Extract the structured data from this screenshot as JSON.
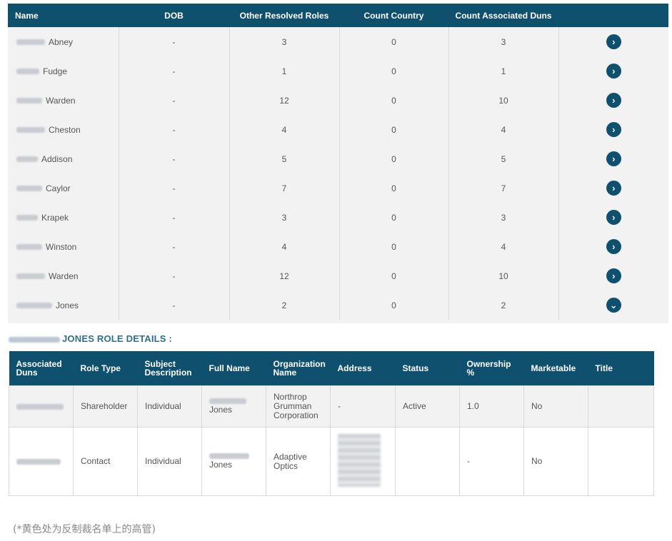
{
  "main_table": {
    "headers": [
      "Name",
      "DOB",
      "Other Resolved Roles",
      "Count Country",
      "Count Associated Duns",
      ""
    ],
    "rows": [
      {
        "surname": "Abney",
        "dob": "-",
        "roles": "3",
        "country": "0",
        "duns": "3",
        "action": "expand"
      },
      {
        "surname": "Fudge",
        "dob": "-",
        "roles": "1",
        "country": "0",
        "duns": "1",
        "action": "expand"
      },
      {
        "surname": "Warden",
        "dob": "-",
        "roles": "12",
        "country": "0",
        "duns": "10",
        "action": "expand"
      },
      {
        "surname": "Cheston",
        "dob": "-",
        "roles": "4",
        "country": "0",
        "duns": "4",
        "action": "expand"
      },
      {
        "surname": "Addison",
        "dob": "-",
        "roles": "5",
        "country": "0",
        "duns": "5",
        "action": "expand"
      },
      {
        "surname": "Caylor",
        "dob": "-",
        "roles": "7",
        "country": "0",
        "duns": "7",
        "action": "expand"
      },
      {
        "surname": "Krapek",
        "dob": "-",
        "roles": "3",
        "country": "0",
        "duns": "3",
        "action": "expand"
      },
      {
        "surname": "Winston",
        "dob": "-",
        "roles": "4",
        "country": "0",
        "duns": "4",
        "action": "expand"
      },
      {
        "surname": "Warden",
        "dob": "-",
        "roles": "12",
        "country": "0",
        "duns": "10",
        "action": "expand"
      },
      {
        "surname": "Jones",
        "dob": "-",
        "roles": "2",
        "country": "0",
        "duns": "2",
        "action": "collapse"
      }
    ]
  },
  "role_details": {
    "title": "JONES ROLE DETAILS :",
    "headers": [
      "Associated Duns",
      "Role Type",
      "Subject Description",
      "Full Name",
      "Organization Name",
      "Address",
      "Status",
      "Ownership %",
      "Marketable",
      "Title"
    ],
    "rows": [
      {
        "role_type": "Shareholder",
        "subject": "Individual",
        "full_name": "Jones",
        "org": "Northrop Grumman Corporation",
        "address": "-",
        "status": "Active",
        "ownership": "1.0",
        "marketable": "No",
        "title": ""
      },
      {
        "role_type": "Contact",
        "subject": "Individual",
        "full_name": "Jones",
        "org": "Adaptive Optics",
        "address": "",
        "status": "",
        "ownership": "-",
        "marketable": "No",
        "title": ""
      }
    ]
  },
  "footnote": "(*黄色处为反制裁名单上的高管)",
  "colors": {
    "header": "#10506f",
    "title": "#2d6f8e",
    "panel": "#f2f2f2"
  },
  "icons": {
    "expand": "chevron-right-icon",
    "collapse": "chevron-down-icon"
  }
}
